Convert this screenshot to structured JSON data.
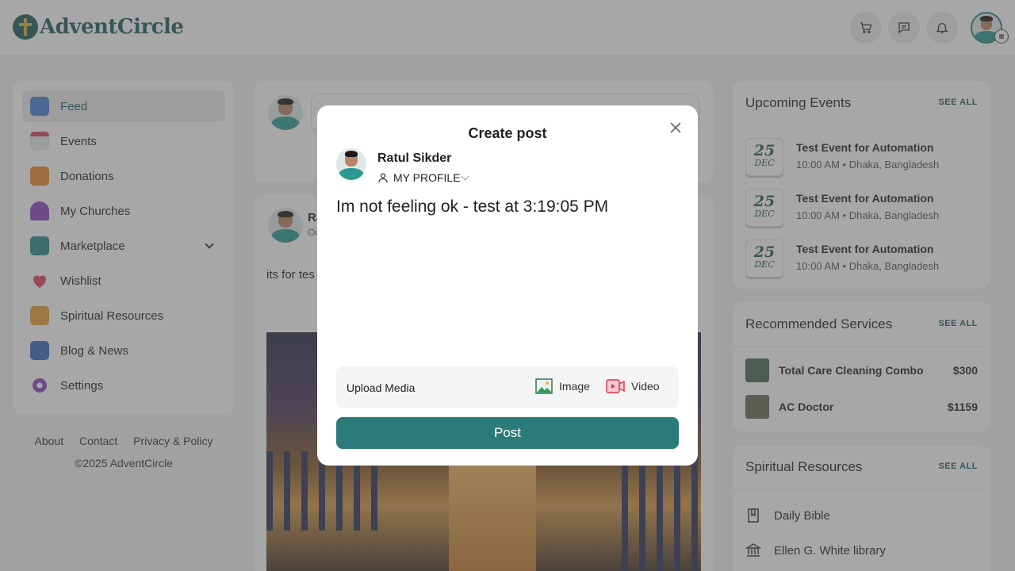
{
  "header": {
    "logo_text": "AdventCircle"
  },
  "sidebar": {
    "items": [
      {
        "label": "Feed",
        "icon": "feed-icon",
        "active": true
      },
      {
        "label": "Events",
        "icon": "calendar-icon"
      },
      {
        "label": "Donations",
        "icon": "donation-box-icon"
      },
      {
        "label": "My Churches",
        "icon": "church-icon"
      },
      {
        "label": "Marketplace",
        "icon": "store-icon",
        "expandable": true
      },
      {
        "label": "Wishlist",
        "icon": "heart-icon"
      },
      {
        "label": "Spiritual Resources",
        "icon": "bible-book-icon"
      },
      {
        "label": "Blog & News",
        "icon": "document-icon"
      },
      {
        "label": "Settings",
        "icon": "gear-icon"
      }
    ]
  },
  "footer": {
    "links": [
      "About",
      "Contact",
      "Privacy & Policy"
    ],
    "copyright": "©2025 AdventCircle"
  },
  "feed": {
    "post": {
      "author_partial": "Ra",
      "date_partial": "Oc",
      "text_partial": "its for tes"
    }
  },
  "right": {
    "events": {
      "title": "Upcoming Events",
      "see_all": "SEE ALL",
      "items": [
        {
          "day": "25",
          "month": "DEC",
          "title": "Test Event for Automation",
          "meta": "10:00 AM • Dhaka, Bangladesh"
        },
        {
          "day": "25",
          "month": "DEC",
          "title": "Test Event for Automation",
          "meta": "10:00 AM • Dhaka, Bangladesh"
        },
        {
          "day": "25",
          "month": "DEC",
          "title": "Test Event for Automation",
          "meta": "10:00 AM • Dhaka, Bangladesh"
        }
      ]
    },
    "services": {
      "title": "Recommended Services",
      "see_all": "SEE ALL",
      "items": [
        {
          "name": "Total Care Cleaning Combo",
          "price": "$300"
        },
        {
          "name": "AC Doctor",
          "price": "$1159"
        }
      ]
    },
    "resources": {
      "title": "Spiritual Resources",
      "see_all": "SEE ALL",
      "items": [
        {
          "label": "Daily Bible",
          "icon": "book-icon"
        },
        {
          "label": "Ellen G. White library",
          "icon": "library-icon"
        }
      ]
    }
  },
  "modal": {
    "title": "Create post",
    "user_name": "Ratul Sikder",
    "audience": "MY PROFILE",
    "text": "Im not feeling ok - test at 3:19:05 PM",
    "upload_label": "Upload Media",
    "image_label": "Image",
    "video_label": "Video",
    "post_label": "Post"
  },
  "colors": {
    "brand": "#1f5e5b",
    "post_button": "#2a7b79"
  }
}
